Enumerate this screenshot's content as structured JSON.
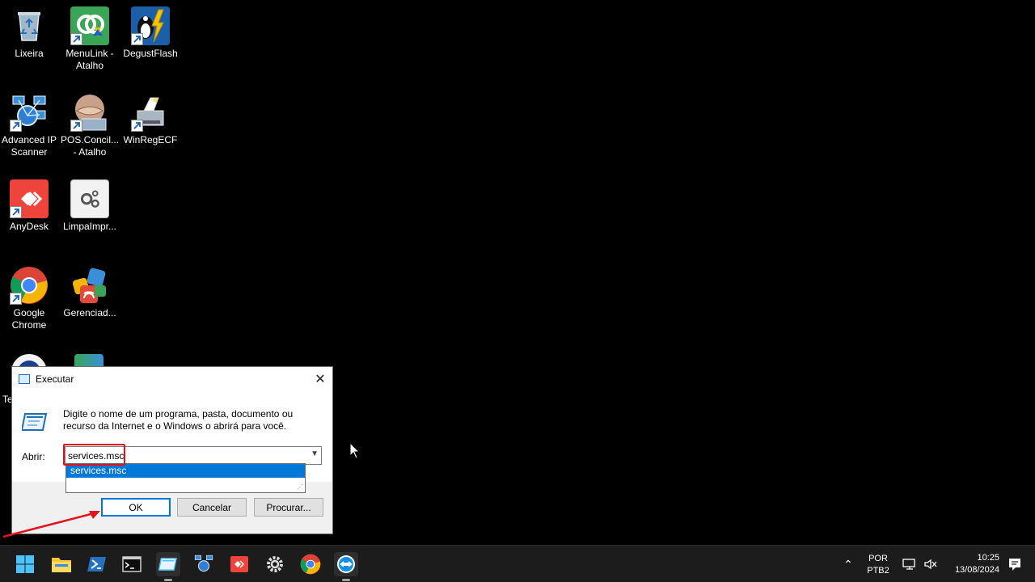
{
  "desktop": {
    "icons": [
      {
        "label": "Lixeira",
        "icon": "recycle-bin-icon"
      },
      {
        "label": "MenuLink - Atalho",
        "icon": "menulink-icon"
      },
      {
        "label": "DegustFlash",
        "icon": "degustflash-icon"
      },
      {
        "label": "Advanced IP Scanner",
        "icon": "network-scanner-icon"
      },
      {
        "label": "POS.Concil... - Atalho",
        "icon": "handshake-icon"
      },
      {
        "label": "WinRegECF",
        "icon": "printer-icon"
      },
      {
        "label": "AnyDesk",
        "icon": "anydesk-icon"
      },
      {
        "label": "LimpaImpr...",
        "icon": "gears-icon"
      },
      {
        "label": "Google Chrome",
        "icon": "chrome-icon"
      },
      {
        "label": "Gerenciad...",
        "icon": "manager-icon"
      },
      {
        "label": "Te",
        "icon": "partial-icon"
      }
    ]
  },
  "run_dialog": {
    "title": "Executar",
    "description": "Digite o nome de um programa, pasta, documento ou recurso da Internet e o Windows o abrirá para você.",
    "open_label": "Abrir:",
    "input_value": "services.msc",
    "autocomplete_option": "services.msc",
    "ok_label": "OK",
    "cancel_label": "Cancelar",
    "browse_label": "Procurar..."
  },
  "taskbar": {
    "apps": [
      "start-icon",
      "file-explorer-icon",
      "powershell-icon",
      "terminal-icon",
      "run-icon",
      "network-scanner-icon",
      "anydesk-icon",
      "settings-icon",
      "chrome-icon",
      "teamviewer-icon"
    ],
    "language_top": "POR",
    "language_bottom": "PTB2",
    "time": "10:25",
    "date": "13/08/2024"
  },
  "colors": {
    "accent": "#0078d7",
    "highlight_red": "#e1141e",
    "taskbar_bg": "#1c1c1c"
  }
}
